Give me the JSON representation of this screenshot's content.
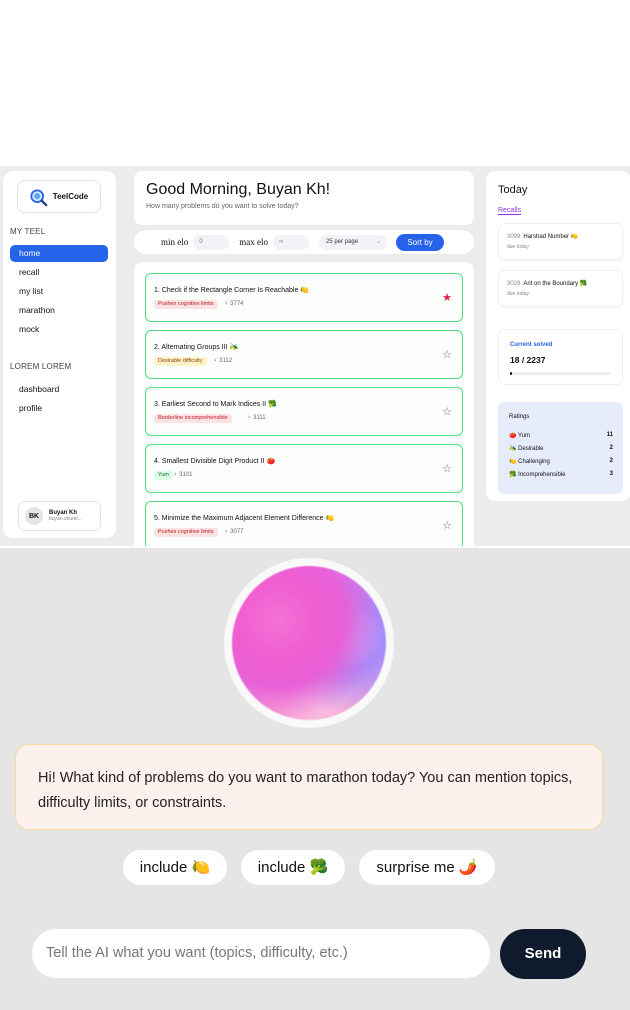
{
  "sidebar": {
    "logo_text": "TeelCode",
    "section1_title": "MY TEEL",
    "section1_items": [
      "home",
      "recall",
      "my list",
      "marathon",
      "mock"
    ],
    "section2_title": "LOREM LOREM",
    "section2_items": [
      "dashboard",
      "profile"
    ],
    "user": {
      "initials": "BK",
      "name": "Buyan Kh",
      "email": "buyan.shurel..."
    }
  },
  "greeting": {
    "title": "Good Morning, Buyan Kh!",
    "subtitle": "How many problems do you want to solve today?"
  },
  "filters": {
    "min_label": "min elo",
    "min_value": "0",
    "max_label": "max elo",
    "max_value": "∞",
    "per_page": "25 per page",
    "sort_label": "Sort by"
  },
  "problems": [
    {
      "title": "1. Check if the Rectangle Corner Is Reachable",
      "emoji": "🍋",
      "badge": "Pushes cognitive limits",
      "badge_kind": "red",
      "elo": "3774",
      "starred": true
    },
    {
      "title": "2. Alternating Groups III",
      "emoji": "🫒",
      "badge": "Desirable difficulty",
      "badge_kind": "yellow",
      "elo": "3112",
      "starred": false
    },
    {
      "title": "3. Earliest Second to Mark Indices II",
      "emoji": "🥦",
      "badge": "Borderline incomprehensible",
      "badge_kind": "red",
      "elo": "3111",
      "starred": false
    },
    {
      "title": "4. Smallest Divisible Digit Product II",
      "emoji": "🍅",
      "badge": "Yum",
      "badge_kind": "green",
      "elo": "3101",
      "starred": false
    },
    {
      "title": "5. Minimize the Maximum Adjacent Element Difference",
      "emoji": "🍋",
      "badge": "Pushes cognitive limits",
      "badge_kind": "red",
      "elo": "3077",
      "starred": false
    }
  ],
  "right_panel": {
    "title": "Today",
    "tab": "Recalls",
    "recalls": [
      {
        "num": "3099",
        "title": "Harshad Number",
        "emoji": "🍋",
        "due": "due today"
      },
      {
        "num": "3028",
        "title": "Ant on the Boundary",
        "emoji": "🥦",
        "due": "due today"
      }
    ],
    "solved_label": "Current solved",
    "solved_value": "18 / 2237",
    "solved_fraction": 0.008,
    "ratings_title": "Ratings",
    "ratings": [
      {
        "icon": "🍅",
        "label": "Yum",
        "count": "11"
      },
      {
        "icon": "🫒",
        "label": "Desirable",
        "count": "2"
      },
      {
        "icon": "🍋",
        "label": "Challenging",
        "count": "2"
      },
      {
        "icon": "🥦",
        "label": "Incomprehensible",
        "count": "3"
      }
    ]
  },
  "chat": {
    "message": "Hi! What kind of problems do you want to marathon today? You can mention topics, difficulty limits, or constraints.",
    "chips": [
      "include 🍋",
      "include 🥦",
      "surprise me 🌶️"
    ],
    "input_placeholder": "Tell the AI what you want (topics, difficulty, etc.)",
    "send_label": "Send"
  }
}
